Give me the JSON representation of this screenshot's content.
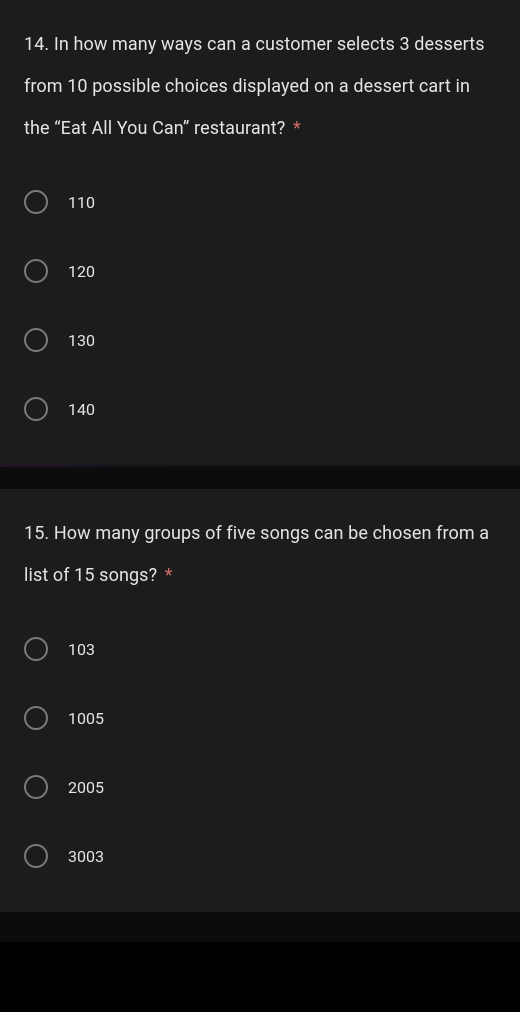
{
  "questions": [
    {
      "number": "14.",
      "text": "In how many ways can a customer selects 3 desserts from 10 possible choices displayed on a dessert cart in the “Eat All You Can” restaurant?",
      "required": "*",
      "options": [
        "110",
        "120",
        "130",
        "140"
      ]
    },
    {
      "number": "15.",
      "text": "How many groups of five songs can be chosen from a list of 15 songs?",
      "required": "*",
      "options": [
        "103",
        "1005",
        "2005",
        "3003"
      ]
    }
  ]
}
